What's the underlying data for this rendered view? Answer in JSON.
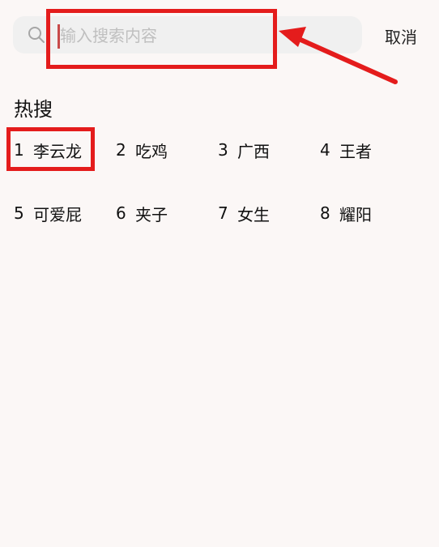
{
  "search": {
    "placeholder": "输入搜索内容",
    "value": ""
  },
  "header": {
    "cancel_label": "取消"
  },
  "hot": {
    "title": "热搜",
    "items": [
      {
        "rank": "1",
        "text": "李云龙"
      },
      {
        "rank": "2",
        "text": "吃鸡"
      },
      {
        "rank": "3",
        "text": "广西"
      },
      {
        "rank": "4",
        "text": "王者"
      },
      {
        "rank": "5",
        "text": "可爱屁"
      },
      {
        "rank": "6",
        "text": "夹子"
      },
      {
        "rank": "7",
        "text": "女生"
      },
      {
        "rank": "8",
        "text": "耀阳"
      }
    ]
  },
  "annotation": {
    "color": "#e41c1c"
  }
}
